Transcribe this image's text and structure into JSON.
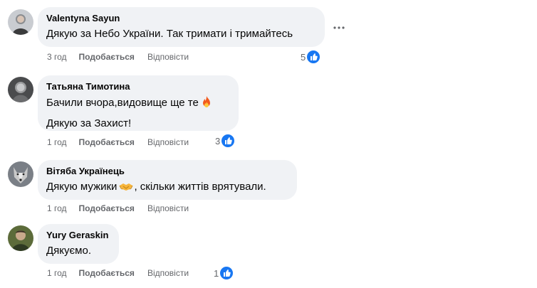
{
  "colors": {
    "bubble": "#f0f2f5",
    "meta_text": "#65676b",
    "like_blue": "#1877f2"
  },
  "comments": [
    {
      "author": "Valentyna Sayun",
      "lines": [
        "Дякую за Небо України. Так тримати і тримайтесь"
      ],
      "time": "3 год",
      "like_label": "Подобається",
      "reply_label": "Відповісти",
      "reactions": "5",
      "avatar_icon": "person-photo"
    },
    {
      "author": "Татьяна Тимотина",
      "lines": [
        "Бачили вчора,видовище ще те",
        "Дякую за Захист!"
      ],
      "emoji": "fire-emoji",
      "time": "1 год",
      "like_label": "Подобається",
      "reply_label": "Відповісти",
      "reactions": "3",
      "avatar_icon": "person-photo"
    },
    {
      "author": "Вітяба Українець",
      "lines": [
        "Дякую мужики",
        ", скільки життів врятували."
      ],
      "emoji": "handshake-emoji",
      "time": "1 год",
      "like_label": "Подобається",
      "reply_label": "Відповісти",
      "reactions": "",
      "avatar_icon": "wolf-photo"
    },
    {
      "author": "Yury Geraskin",
      "lines": [
        "Дякуємо."
      ],
      "time": "1 год",
      "like_label": "Подобається",
      "reply_label": "Відповісти",
      "reactions": "1",
      "avatar_icon": "person-photo"
    }
  ],
  "more_icon": "more-horizontal-icon",
  "like_icon": "thumbs-up-icon"
}
